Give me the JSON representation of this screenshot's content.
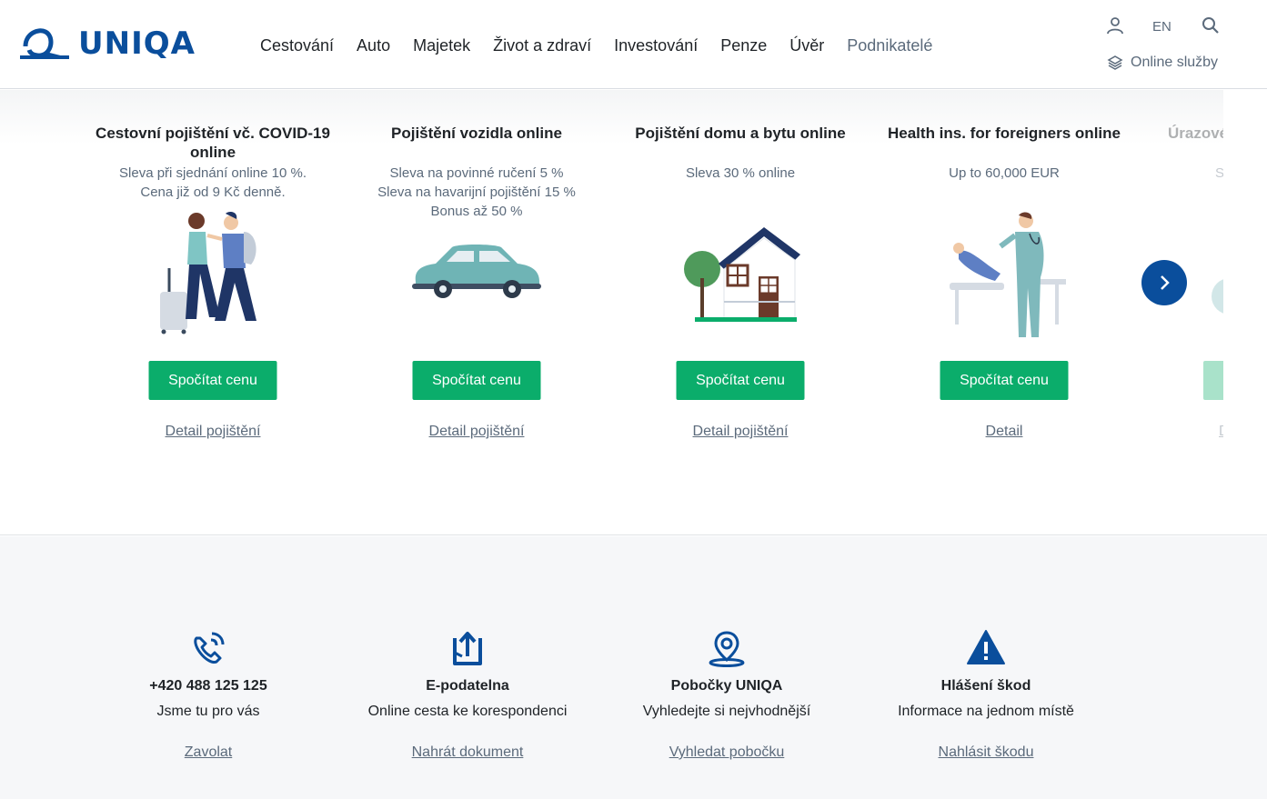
{
  "brand": {
    "logo_text": "UNIQA",
    "color": "#0a4e9c"
  },
  "nav": {
    "items": [
      "Cestování",
      "Auto",
      "Majetek",
      "Život a zdraví",
      "Investování",
      "Penze",
      "Úvěr",
      "Podnikatelé"
    ]
  },
  "top_right": {
    "lang": "EN",
    "online_services": "Online služby"
  },
  "products": [
    {
      "title": "Cestovní pojištění vč. COVID-19 online",
      "sub": [
        "Sleva při sjednání online 10 %.",
        "Cena již od 9 Kč denně."
      ],
      "button": "Spočítat cenu",
      "link": "Detail pojištění",
      "icon": "travel-couple-illustration"
    },
    {
      "title": "Pojištění vozidla online",
      "sub": [
        "Sleva na povinné ručení 5 %",
        "Sleva na havarijní pojištění 15 %",
        "Bonus až 50 %"
      ],
      "button": "Spočítat cenu",
      "link": "Detail pojištění",
      "icon": "car-illustration"
    },
    {
      "title": "Pojištění domu a bytu online",
      "sub": [
        "Sleva 30 % online"
      ],
      "button": "Spočítat cenu",
      "link": "Detail pojištění",
      "icon": "house-illustration"
    },
    {
      "title": "Health ins. for foreigners online",
      "sub": [
        "Up to 60,000 EUR"
      ],
      "button": "Spočítat cenu",
      "link": "Detail",
      "icon": "doctor-illustration"
    },
    {
      "title": "Úrazové",
      "sub": [
        "Sl"
      ],
      "button": "",
      "link": "D",
      "icon": "accident-illustration"
    }
  ],
  "contacts": [
    {
      "title": "+420 488 125 125",
      "desc": "Jsme tu pro vás",
      "link": "Zavolat",
      "icon": "phone-icon"
    },
    {
      "title": "E-podatelna",
      "desc": "Online cesta ke korespondenci",
      "link": "Nahrát dokument",
      "icon": "upload-icon"
    },
    {
      "title": "Pobočky UNIQA",
      "desc": "Vyhledejte si nejvhodnější",
      "link": "Vyhledat pobočku",
      "icon": "location-pin-icon"
    },
    {
      "title": "Hlášení škod",
      "desc": "Informace na jednom místě",
      "link": "Nahlásit škodu",
      "icon": "warning-icon"
    }
  ],
  "colors": {
    "primary": "#0a4e9c",
    "accent_green": "#0bad6b",
    "muted_text": "#5b6a7b"
  }
}
